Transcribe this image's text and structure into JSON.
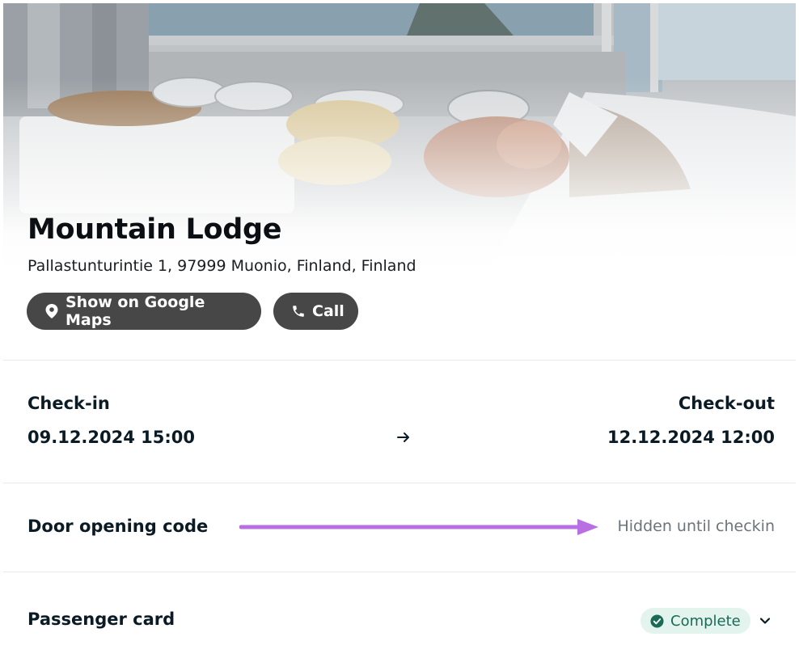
{
  "property": {
    "name": "Mountain Lodge",
    "address": "Pallastunturintie 1, 97999 Muonio, Finland, Finland"
  },
  "actions": {
    "maps_label": "Show on Google Maps",
    "call_label": "Call"
  },
  "stay": {
    "checkin_label": "Check-in",
    "checkin_value": "09.12.2024 15:00",
    "checkout_label": "Check-out",
    "checkout_value": "12.12.2024 12:00"
  },
  "door": {
    "label": "Door opening code",
    "value": "Hidden until checkin"
  },
  "passenger": {
    "label": "Passenger card",
    "status": "Complete"
  },
  "colors": {
    "button_bg": "#474747",
    "annotation_arrow": "#b76fe3",
    "status_bg": "#e3f3ee",
    "status_text": "#1a6b55",
    "muted_text": "#6b7479"
  },
  "icons": {
    "maps": "map-pin-icon",
    "call": "phone-icon",
    "status": "check-circle-icon",
    "expand": "chevron-down-icon",
    "direction": "arrow-right-icon"
  }
}
